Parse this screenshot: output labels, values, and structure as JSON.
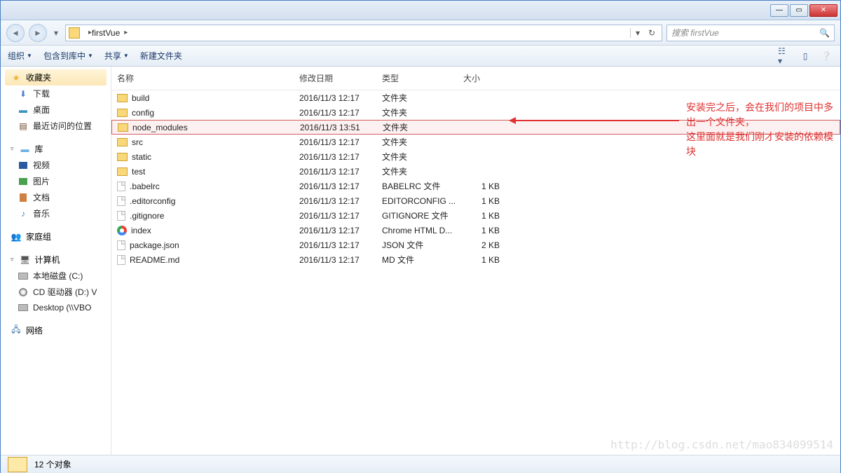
{
  "titlebar": {},
  "nav": {
    "path_label": "firstVue",
    "path_sep": "▸",
    "search_placeholder": "搜索 firstVue"
  },
  "toolbar": {
    "organize": "组织",
    "include": "包含到库中",
    "share": "共享",
    "newfolder": "新建文件夹"
  },
  "sidebar": {
    "favorites": "收藏夹",
    "downloads": "下载",
    "desktop": "桌面",
    "recent": "最近访问的位置",
    "libraries": "库",
    "videos": "视频",
    "pictures": "图片",
    "documents": "文档",
    "music": "音乐",
    "homegroup": "家庭组",
    "computer": "计算机",
    "drive_c": "本地磁盘 (C:)",
    "drive_d": "CD 驱动器 (D:) V",
    "drive_desk": "Desktop (\\\\VBO",
    "network": "网络"
  },
  "columns": {
    "name": "名称",
    "modified": "修改日期",
    "type": "类型",
    "size": "大小"
  },
  "files": [
    {
      "icon": "folder",
      "name": "build",
      "modified": "2016/11/3 12:17",
      "type": "文件夹",
      "size": ""
    },
    {
      "icon": "folder",
      "name": "config",
      "modified": "2016/11/3 12:17",
      "type": "文件夹",
      "size": ""
    },
    {
      "icon": "folder",
      "name": "node_modules",
      "modified": "2016/11/3 13:51",
      "type": "文件夹",
      "size": "",
      "selected": true
    },
    {
      "icon": "folder",
      "name": "src",
      "modified": "2016/11/3 12:17",
      "type": "文件夹",
      "size": ""
    },
    {
      "icon": "folder",
      "name": "static",
      "modified": "2016/11/3 12:17",
      "type": "文件夹",
      "size": ""
    },
    {
      "icon": "folder",
      "name": "test",
      "modified": "2016/11/3 12:17",
      "type": "文件夹",
      "size": ""
    },
    {
      "icon": "file",
      "name": ".babelrc",
      "modified": "2016/11/3 12:17",
      "type": "BABELRC 文件",
      "size": "1 KB"
    },
    {
      "icon": "file",
      "name": ".editorconfig",
      "modified": "2016/11/3 12:17",
      "type": "EDITORCONFIG ...",
      "size": "1 KB"
    },
    {
      "icon": "file",
      "name": ".gitignore",
      "modified": "2016/11/3 12:17",
      "type": "GITIGNORE 文件",
      "size": "1 KB"
    },
    {
      "icon": "chrome",
      "name": "index",
      "modified": "2016/11/3 12:17",
      "type": "Chrome HTML D...",
      "size": "1 KB"
    },
    {
      "icon": "file",
      "name": "package.json",
      "modified": "2016/11/3 12:17",
      "type": "JSON 文件",
      "size": "2 KB"
    },
    {
      "icon": "file",
      "name": "README.md",
      "modified": "2016/11/3 12:17",
      "type": "MD 文件",
      "size": "1 KB"
    }
  ],
  "annotation": {
    "line1": "安装完之后，会在我们的项目中多出一个文件夹，",
    "line2": "这里面就是我们刚才安装的依赖模块"
  },
  "status": {
    "text": "12 个对象"
  },
  "watermark": "http://blog.csdn.net/mao834099514"
}
